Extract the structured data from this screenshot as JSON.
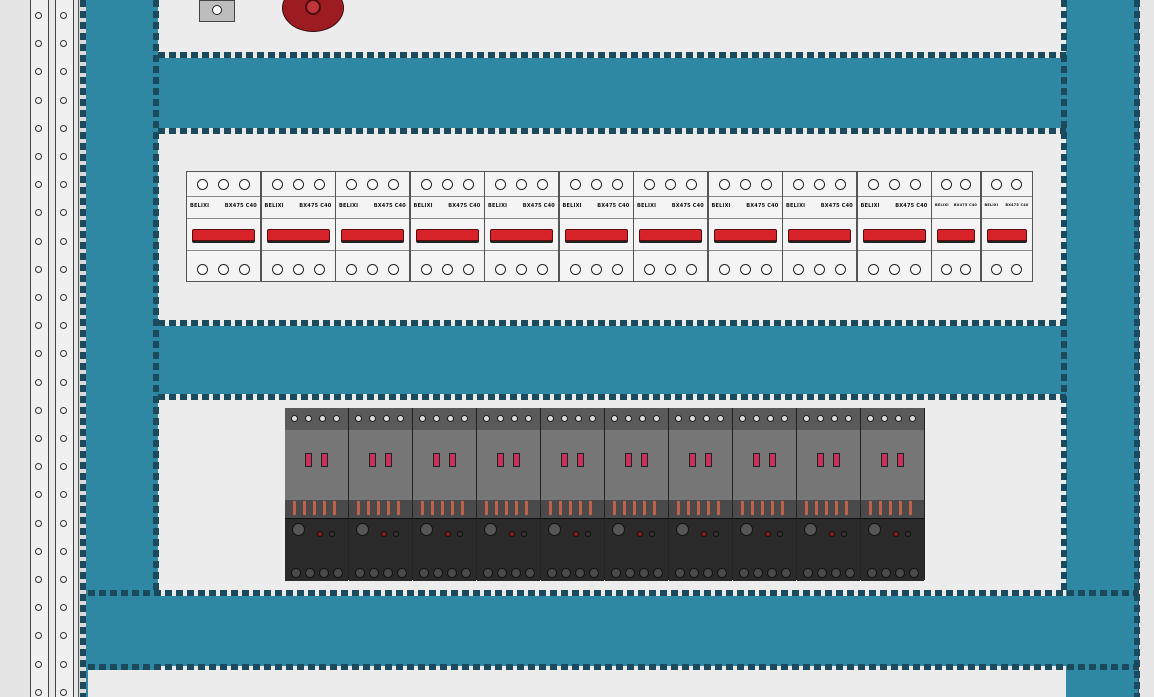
{
  "colors": {
    "frame": "#2e87a3",
    "frame_dash": "#1b4a5c",
    "panel": "#ececec",
    "lever": "#d8232a",
    "contactor": "#6e6e6e",
    "relay": "#2a2a2a",
    "stop_button": "#9c1c22"
  },
  "breakers": [
    {
      "brand": "BELIXI",
      "model": "BX475 C40"
    },
    {
      "brand": "BELIXI",
      "model": "BX475 C40"
    },
    {
      "brand": "BELIXI",
      "model": "BX475 C40"
    },
    {
      "brand": "BELIXI",
      "model": "BX475 C40"
    },
    {
      "brand": "BELIXI",
      "model": "BX475 C40"
    },
    {
      "brand": "BELIXI",
      "model": "BX475 C40"
    },
    {
      "brand": "BELIXI",
      "model": "BX475 C40"
    },
    {
      "brand": "BELIXI",
      "model": "BX475 C40"
    },
    {
      "brand": "BELIXI",
      "model": "BX475 C40"
    },
    {
      "brand": "BELIXI",
      "model": "BX475 C40"
    },
    {
      "brand": "BELIXI",
      "model": "BX475 C40"
    },
    {
      "brand": "BELIXI",
      "model": "BX475 C40"
    }
  ],
  "contactor_count": 10,
  "icons": {
    "selector_switch": "selector-switch-icon",
    "stop_button": "emergency-stop-icon"
  }
}
